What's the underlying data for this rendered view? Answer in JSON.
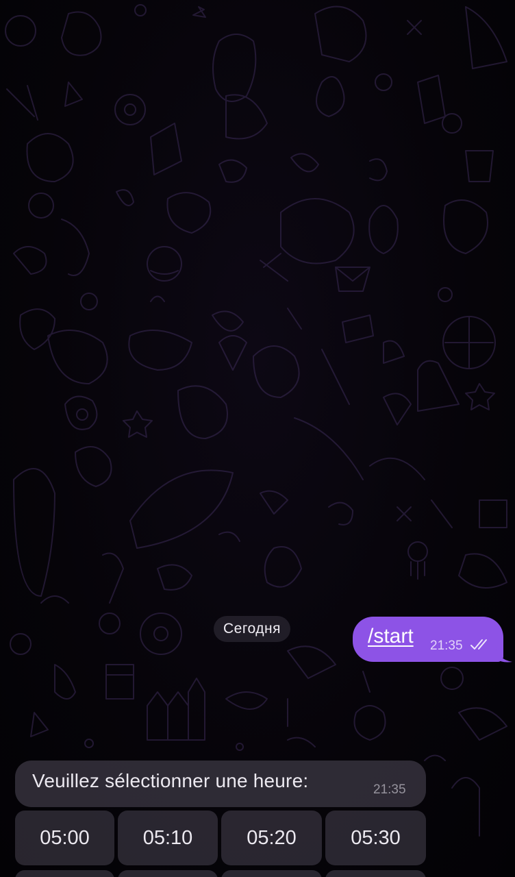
{
  "chat": {
    "date_separator": "Сегодня",
    "outgoing_message": {
      "text": "/start",
      "time": "21:35",
      "status_icon": "double-check-icon",
      "bubble_color": "#8d53e6"
    },
    "incoming_message": {
      "text": "Veuillez sélectionner une heure:",
      "time": "21:35"
    },
    "inline_keyboard": {
      "row1": [
        "05:00",
        "05:10",
        "05:20",
        "05:30"
      ]
    }
  },
  "theme": {
    "background": "#050307",
    "wallpaper_stroke": "#3a2a55"
  }
}
